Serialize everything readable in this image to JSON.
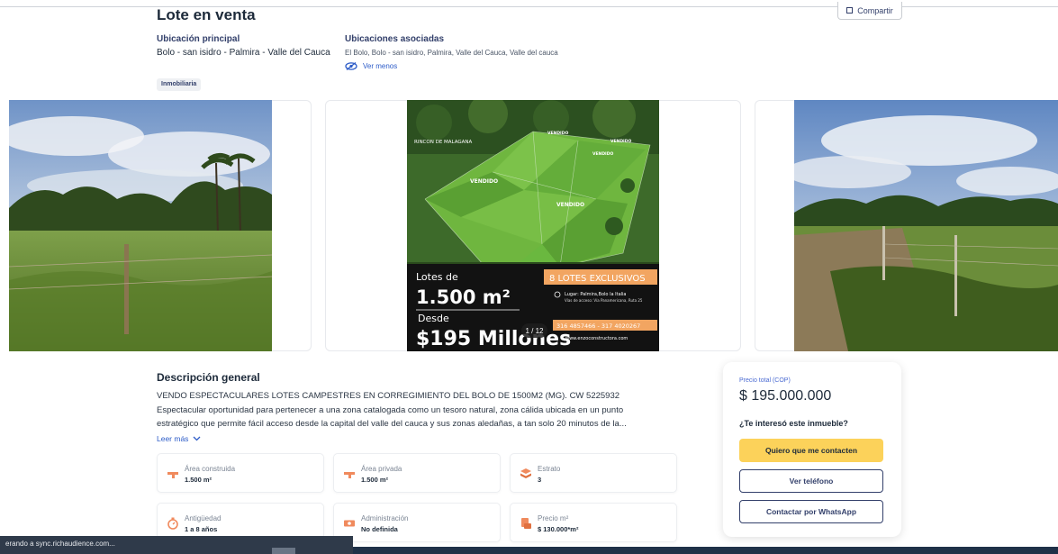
{
  "header": {
    "title": "Lote en venta",
    "share_label": "Compartir"
  },
  "location": {
    "main_label": "Ubicación principal",
    "main_value": "Bolo - san isidro - Palmira - Valle del Cauca",
    "assoc_label": "Ubicaciones asociadas",
    "assoc_value": "El Bolo, Bolo - san isidro, Palmira, Valle del Cauca, Valle del cauca",
    "toggle_label": "Ver menos"
  },
  "badge": "Inmobiliaria",
  "gallery": {
    "counter": "1 / 12",
    "poster": {
      "place": "RINCON DE MALAGANA",
      "sold_1": "VENDIDO",
      "sold_2": "VENDIDO",
      "sold_3": "VENDIDO",
      "sold_4": "VENDIDO",
      "lots_label": "Lotes de",
      "area": "1.500 m²",
      "from_label": "Desde",
      "price": "$195 Millones",
      "exclusive": "8 LOTES EXCLUSIVOS",
      "place_line": "Lugar: Palmira,Bolo la Italia",
      "access_line": "Vías de acceso: Vía Panamericana, Ruta 25",
      "phone": "316 4857466 - 317 4020267",
      "web": "www.enzoconstructora.com"
    }
  },
  "description": {
    "title": "Descripción general",
    "line1": "VENDO ESPECTACULARES LOTES CAMPESTRES EN CORREGIMIENTO DEL BOLO DE 1500M2 (MG). CW 5225932",
    "line2": "Espectacular oportunidad para pertenecer a una zona catalogada como un tesoro natural, zona cálida ubicada en un punto",
    "line3": "estratégico que permite fácil acceso desde la capital del valle del cauca y sus zonas aledañas, a tan solo 20 minutos de la...",
    "more_label": "Leer más"
  },
  "features": [
    {
      "label": "Área construida",
      "value": "1.500 m²",
      "icon": "ruler-icon"
    },
    {
      "label": "Área privada",
      "value": "1.500 m²",
      "icon": "ruler-icon"
    },
    {
      "label": "Estrato",
      "value": "3",
      "icon": "layers-icon"
    },
    {
      "label": "Antigüedad",
      "value": "1 a 8 años",
      "icon": "hourglass-icon"
    },
    {
      "label": "Administración",
      "value": "No definida",
      "icon": "money-icon"
    },
    {
      "label": "Precio m²",
      "value": "$ 130.000*m²",
      "icon": "price-tag-icon"
    }
  ],
  "price_card": {
    "label": "Precio total (COP)",
    "value": "$ 195.000.000",
    "question": "¿Te interesó este inmueble?",
    "contact_label": "Quiero que me contacten",
    "phone_label": "Ver teléfono",
    "whatsapp_label": "Contactar por WhatsApp"
  },
  "status_bar": {
    "text": "erando a sync.richaudience.com..."
  },
  "colors": {
    "primary_text": "#1d2a3a",
    "accent_blue": "#2d5cc8",
    "navy": "#33406b",
    "cta_yellow": "#fcd25a"
  }
}
